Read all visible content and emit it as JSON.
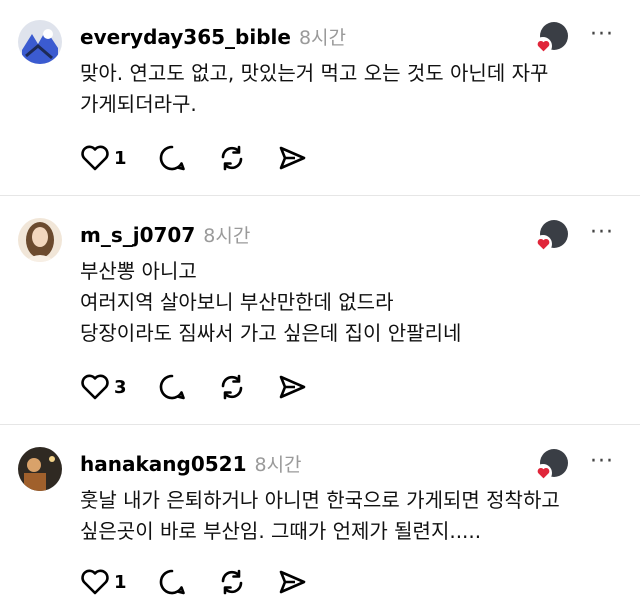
{
  "posts": [
    {
      "username": "everyday365_bible",
      "time": "8시간",
      "text": "맞아. 연고도 없고, 맛있는거 먹고 오는 것도 아닌데 자꾸\n가게되더라구.",
      "likes": "1",
      "avatar_colors": [
        "#d8dde8",
        "#3b5bd0",
        "#e8e2d5"
      ]
    },
    {
      "username": "m_s_j0707",
      "time": "8시간",
      "text": "부산뽕 아니고\n여러지역 살아보니 부산만한데 없드라\n당장이라도 짐싸서 가고 싶은데 집이 안팔리네",
      "likes": "3",
      "avatar_colors": [
        "#e9d7c4",
        "#6b4a2e",
        "#f3e7da"
      ]
    },
    {
      "username": "hanakang0521",
      "time": "8시간",
      "text": "훗날 내가 은퇴하거나 아니면 한국으로 가게되면 정착하고\n싶은곳이 바로 부산임. 그때가 언제가 될련지.....",
      "likes": "1",
      "avatar_colors": [
        "#3a3228",
        "#a0602c",
        "#d9a26a"
      ]
    }
  ],
  "more_label": "···",
  "colors": {
    "heart": "#e0263a",
    "time": "#9a9a9a",
    "divider": "#e6e6e6"
  }
}
